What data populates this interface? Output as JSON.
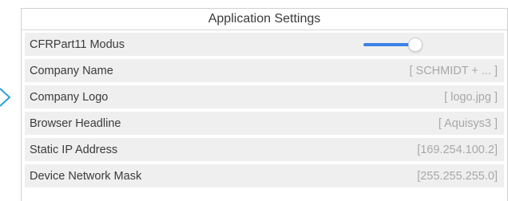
{
  "panel": {
    "title": "Application Settings"
  },
  "settings": [
    {
      "label": "CFRPart11 Modus",
      "type": "toggle",
      "checked": true
    },
    {
      "label": "Company Name",
      "value": "[ SCHMIDT + ... ]"
    },
    {
      "label": "Company Logo",
      "value": "[ logo.jpg ]"
    },
    {
      "label": "Browser Headline",
      "value": "[ Aquisys3 ]"
    },
    {
      "label": "Static IP Address",
      "value": "[169.254.100.2]"
    },
    {
      "label": "Device Network Mask",
      "value": "[255.255.255.0]"
    }
  ],
  "colors": {
    "accent": "#3b82e6",
    "row_background": "#efefef",
    "value_text": "#a8a8a8"
  },
  "icons": {
    "left_marker": "chevron-right-icon"
  }
}
